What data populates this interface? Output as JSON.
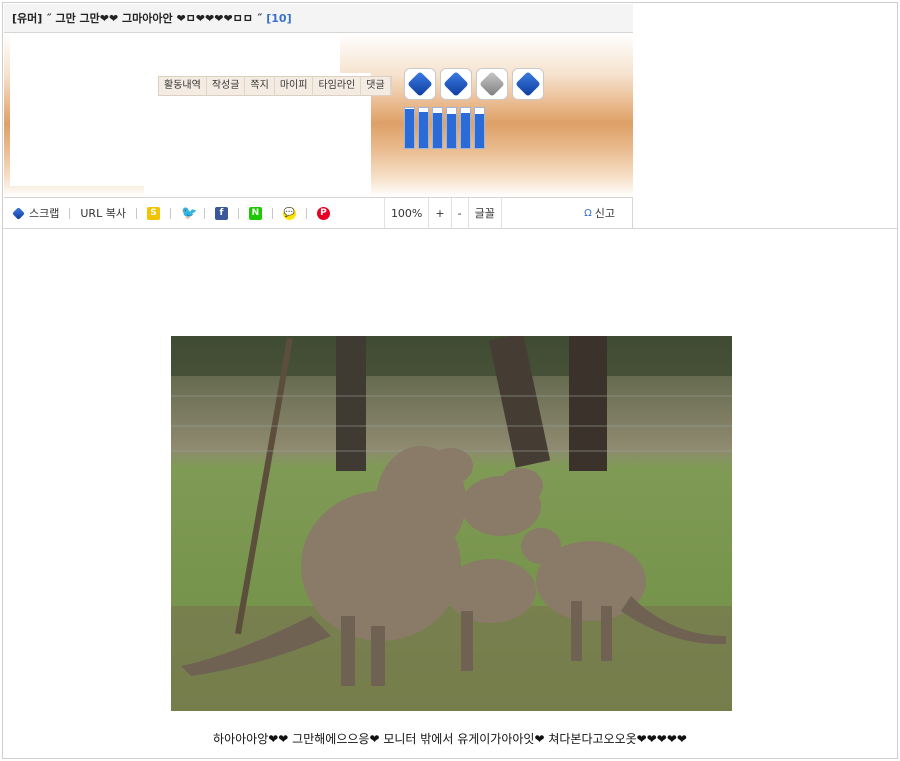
{
  "title": {
    "text": "[유머] ˝ 그만 그만❤❤ 그마아아안 ❤ㅁ❤❤❤❤ㅁㅁ ˝",
    "count": "[10]"
  },
  "profile_tabs": [
    "활동내역",
    "작성글",
    "쪽지",
    "마이피",
    "타임라인",
    "댓글"
  ],
  "badges": [
    {
      "icon": "blue-cube-badge-icon"
    },
    {
      "icon": "blue-cube-badge-icon"
    },
    {
      "icon": "gray-badge-icon"
    },
    {
      "icon": "blue-cube-badge-icon"
    }
  ],
  "level_bars": [
    0.97,
    0.9,
    0.88,
    0.86,
    0.88,
    0.86
  ],
  "toolbar": {
    "scrap": "스크랩",
    "url_copy": "URL 복사",
    "share": [
      {
        "name": "kakaostory",
        "glyph": "S"
      },
      {
        "name": "twitter",
        "glyph": "🐦"
      },
      {
        "name": "facebook",
        "glyph": "f"
      },
      {
        "name": "naver",
        "glyph": "N"
      },
      {
        "name": "kakaotalk",
        "glyph": "💬"
      },
      {
        "name": "pinterest",
        "glyph": "P"
      }
    ],
    "zoom_value": "100%",
    "zoom_in": "+",
    "zoom_out": "-",
    "font": "글꼴",
    "report": "신고"
  },
  "caption": "하아아아앙❤❤ 그만해에으으응❤ 모니터 밖에서 유게이가아아잇❤ 쳐다본다고오오옷❤❤❤❤❤",
  "colors": {
    "accent": "#3a70c8",
    "banner": "#dda066"
  }
}
